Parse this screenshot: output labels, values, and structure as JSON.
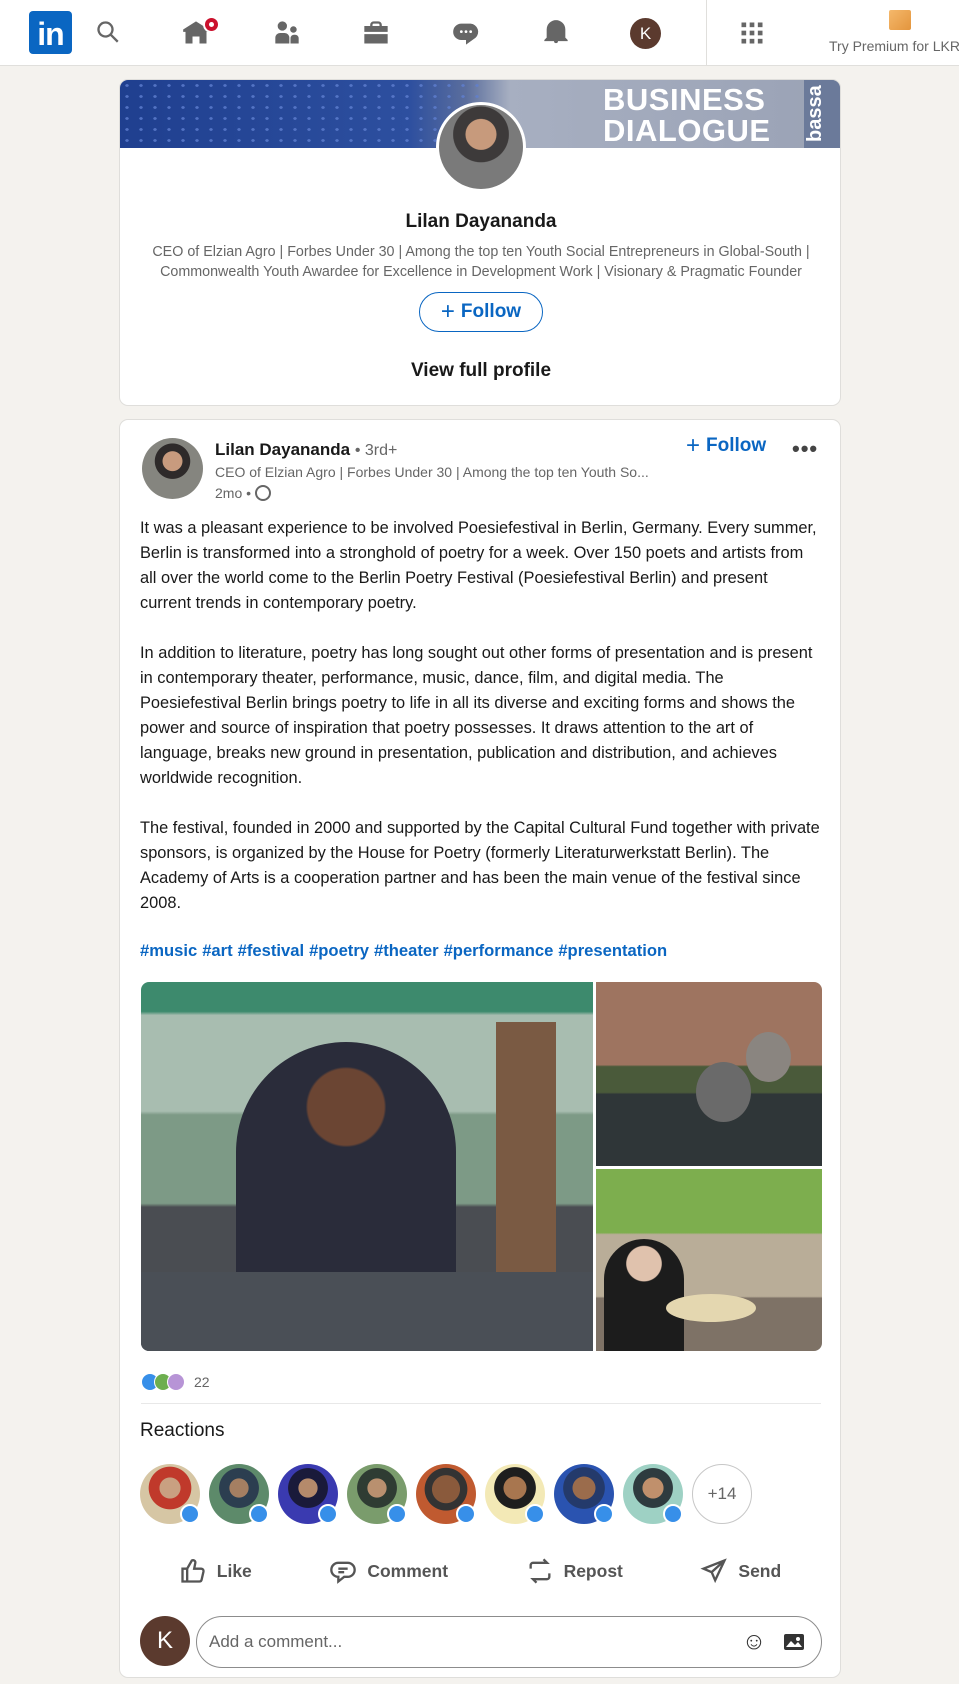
{
  "nav": {
    "logo_text": "in",
    "premium_text": "Try Premium for LKR",
    "me_initial": "K",
    "icons": [
      "search-icon",
      "home-icon",
      "my-network-icon",
      "jobs-icon",
      "messaging-icon",
      "notifications-icon",
      "me-avatar",
      "work-grid-icon"
    ]
  },
  "profile_card": {
    "banner_text": "BUSINESS\nDIALOGUE",
    "banner_side_text": "bassa",
    "name": "Lilan Dayananda",
    "headline": "CEO of Elzian Agro | Forbes Under 30 | Among the top ten Youth Social Entrepreneurs in Global-South | Commonwealth Youth Awardee for Excellence in Development Work | Visionary & Pragmatic Founder",
    "follow_label": "Follow",
    "view_profile_label": "View full profile"
  },
  "post": {
    "author_name": "Lilan Dayananda",
    "degree": "• 3rd+",
    "author_headline": "CEO of Elzian Agro | Forbes Under 30 | Among the top ten Youth So...",
    "time": "2mo •",
    "follow_label": "Follow",
    "more_label": "•••",
    "paragraphs": [
      "It was a pleasant experience to be involved Poesiefestival in Berlin, Germany. Every summer, Berlin is transformed into a stronghold of poetry for a week. Over 150 poets and artists from all over the world come to the Berlin Poetry Festival (Poesiefestival Berlin) and present current trends in contemporary poetry.",
      "In addition to literature, poetry has long sought out other forms of presentation and is present in contemporary theater, performance, music, dance, film, and digital media. The Poesiefestival Berlin brings poetry to life in all its diverse and exciting forms and shows the power and source of inspiration that poetry possesses. It draws attention to the art of language, breaks new ground in presentation, publication and distribution, and achieves worldwide recognition.",
      "The festival, founded in 2000 and supported by the Capital Cultural Fund together with private sponsors, is organized by the House for Poetry (formerly Literaturwerkstatt Berlin). The Academy of Arts is a cooperation partner and has been the main venue of the festival since 2008."
    ],
    "hashtags": [
      "#music",
      "#art",
      "#festival",
      "#poetry",
      "#theater",
      "#performance",
      "#presentation"
    ],
    "reaction_count": "22",
    "reactions_title": "Reactions",
    "more_reactors": "+14",
    "actions": {
      "like": "Like",
      "comment": "Comment",
      "repost": "Repost",
      "send": "Send"
    },
    "comment_placeholder": "Add a comment...",
    "commenter_initial": "K"
  },
  "colors": {
    "brand_blue": "#0a66c2",
    "like_blue": "#378fe9",
    "page_bg": "#f4f2ee",
    "notification_red": "#cb112d"
  }
}
